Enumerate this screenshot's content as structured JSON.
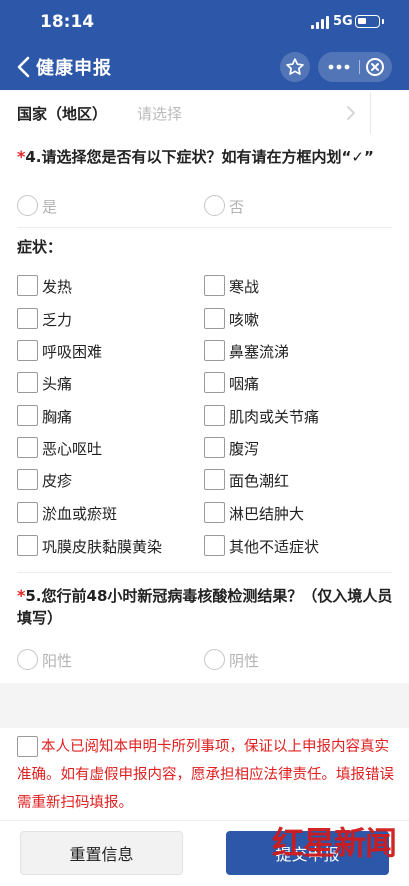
{
  "status_bar": {
    "time": "18:14",
    "network": "5G"
  },
  "nav": {
    "title": "健康申报",
    "back_icon": "chevron-left-icon",
    "star_icon": "star-icon",
    "more_icon": "more-icon",
    "close_icon": "close-circle-icon"
  },
  "country": {
    "label": "国家（地区）",
    "placeholder": "请选择"
  },
  "q4": {
    "required_mark": "*",
    "title": "4.请选择您是否有以下症状？如有请在方框内划“✓”",
    "options": [
      "是",
      "否"
    ]
  },
  "symptoms": {
    "heading": "症状：",
    "items": [
      "发热",
      "寒战",
      "乏力",
      "咳嗽",
      "呼吸困难",
      "鼻塞流涕",
      "头痛",
      "咽痛",
      "胸痛",
      "肌肉或关节痛",
      "恶心呕吐",
      "腹泻",
      "皮疹",
      "面色潮红",
      "淤血或瘀斑",
      "淋巴结肿大",
      "巩膜皮肤黏膜黄染",
      "其他不适症状"
    ]
  },
  "q5": {
    "required_mark": "*",
    "title": "5.您行前48小时新冠病毒核酸检测结果？（仅入境人员填写）",
    "options": [
      "阳性",
      "阴性"
    ]
  },
  "agreement": {
    "text": "本人已阅知本申明卡所列事项，保证以上申报内容真实准确。如有虚假申报内容，愿承担相应法律责任。填报错误需重新扫码填报。"
  },
  "footer": {
    "reset_label": "重置信息",
    "submit_label": "提交申报"
  },
  "watermark": {
    "text": "红星新闻"
  },
  "colors": {
    "brand": "#2d57a8",
    "required": "#e32626",
    "agreement": "#e02020"
  }
}
